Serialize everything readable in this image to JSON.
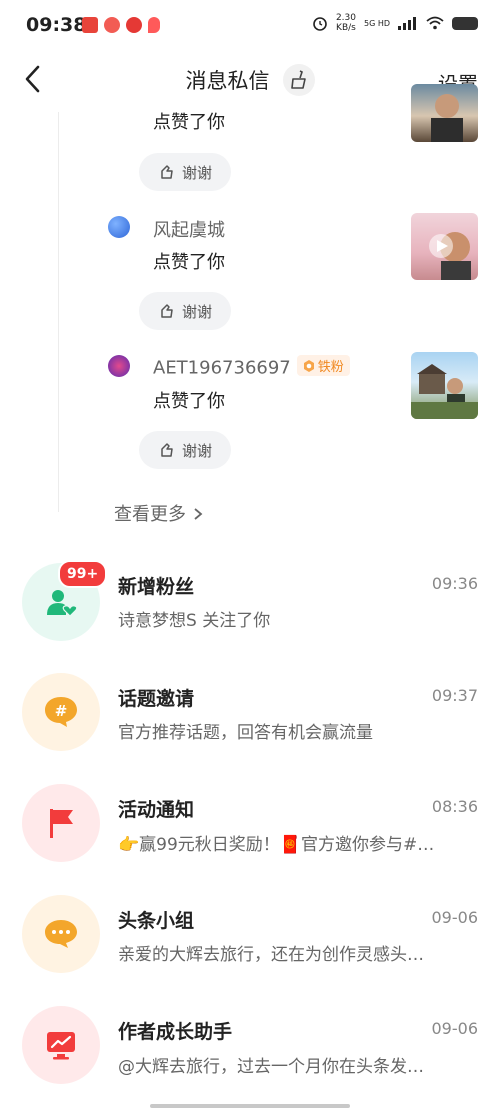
{
  "status_bar": {
    "time": "09:38",
    "net_speed_value": "2.30",
    "net_speed_unit": "KB/s",
    "network": "5G HD"
  },
  "header": {
    "title": "消息私信",
    "settings_label": "设置"
  },
  "likes": [
    {
      "name": "",
      "text": "点赞了你",
      "avatar_color": "#cccccc",
      "thumb_colors": [
        "#d7c8b4",
        "#6b5a48"
      ]
    },
    {
      "name": "风起虞城",
      "text": "点赞了你",
      "thanks_label": "谢谢",
      "avatar_color": "#3f7fe0",
      "thumb_colors": [
        "#e9b7c0",
        "#8d6e63"
      ]
    },
    {
      "name": "AET196736697",
      "badge": "铁粉",
      "text": "点赞了你",
      "thanks_label": "谢谢",
      "avatar_color": "#7b3fc0",
      "thumb_colors": [
        "#8fc0e8",
        "#5a6e3e"
      ]
    }
  ],
  "first_thanks_label": "谢谢",
  "see_more_label": "查看更多",
  "messages": [
    {
      "title": "新增粉丝",
      "time": "09:36",
      "subtitle": "诗意梦想S 关注了你",
      "badge": "99+",
      "icon": "person-heart-icon",
      "bg": "#e7f8f2",
      "fg": "#20b87a"
    },
    {
      "title": "话题邀请",
      "time": "09:37",
      "subtitle": "官方推荐话题，回答有机会赢流量",
      "icon": "hashtag-bubble-icon",
      "bg": "#fff3e2",
      "fg": "#f3a62b"
    },
    {
      "title": "活动通知",
      "time": "08:36",
      "subtitle": "👉赢99元秋日奖励！🧧官方邀你参与#…",
      "icon": "flag-icon",
      "bg": "#ffe9ea",
      "fg": "#f23c3c"
    },
    {
      "title": "头条小组",
      "time": "09-06",
      "subtitle": "亲爱的大辉去旅行，还在为创作灵感头…",
      "icon": "chat-dots-icon",
      "bg": "#fff3e2",
      "fg": "#f3a62b"
    },
    {
      "title": "作者成长助手",
      "time": "09-06",
      "subtitle": "@大辉去旅行，过去一个月你在头条发…",
      "icon": "growth-chart-icon",
      "bg": "#ffe9ea",
      "fg": "#f23c3c"
    }
  ]
}
